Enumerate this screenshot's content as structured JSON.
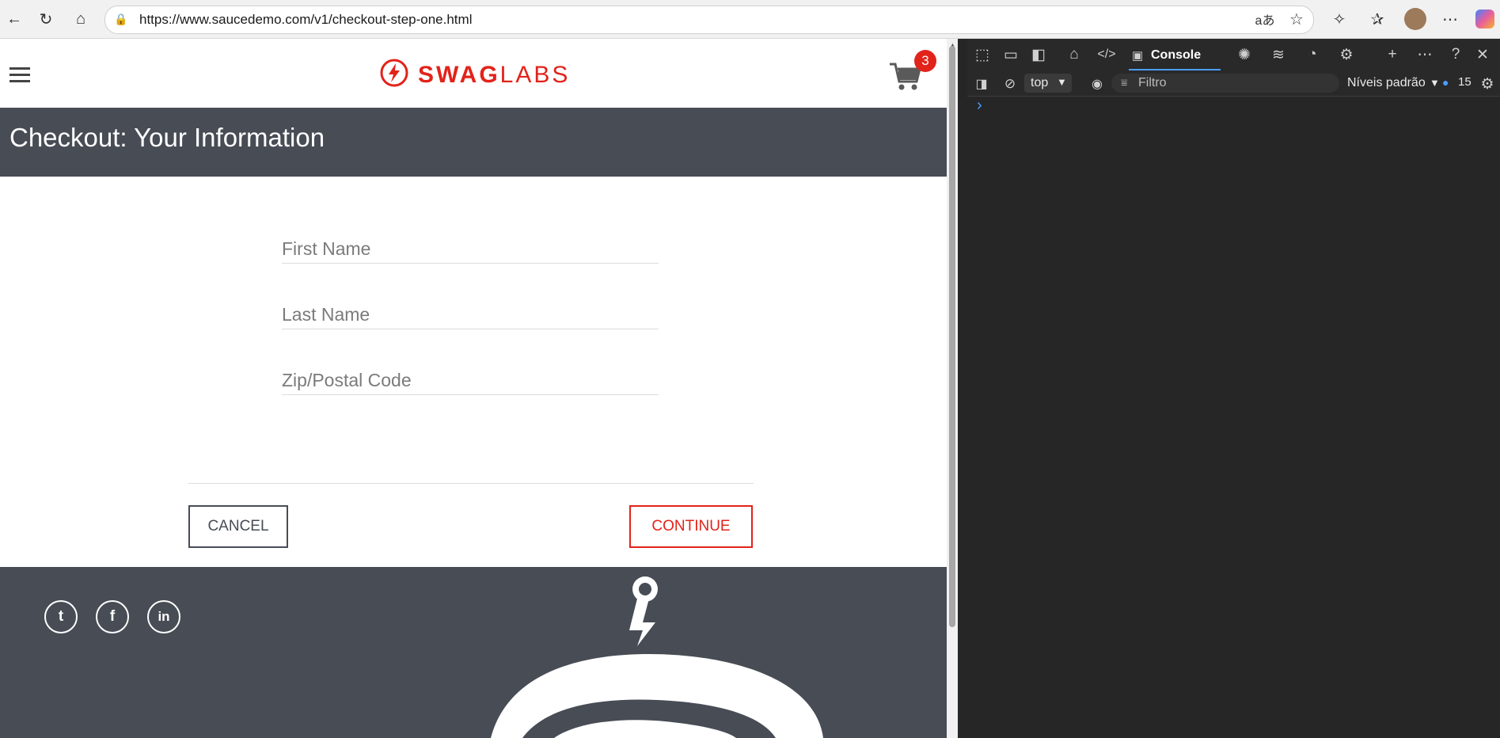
{
  "browser": {
    "url": "https://www.saucedemo.com/v1/checkout-step-one.html"
  },
  "header": {
    "logo_swag": "SWAG",
    "logo_labs": "LABS",
    "cart_count": "3"
  },
  "page": {
    "title": "Checkout: Your Information",
    "first_name_placeholder": "First Name",
    "last_name_placeholder": "Last Name",
    "zip_placeholder": "Zip/Postal Code",
    "cancel_label": "CANCEL",
    "continue_label": "CONTINUE"
  },
  "devtools": {
    "console_tab": "Console",
    "context": "top",
    "filter_placeholder": "Filtro",
    "levels": "Níveis padrão",
    "issues_count": "15",
    "prompt": "›"
  },
  "colors": {
    "brand_red": "#e2231a",
    "header_gray": "#474c55"
  }
}
